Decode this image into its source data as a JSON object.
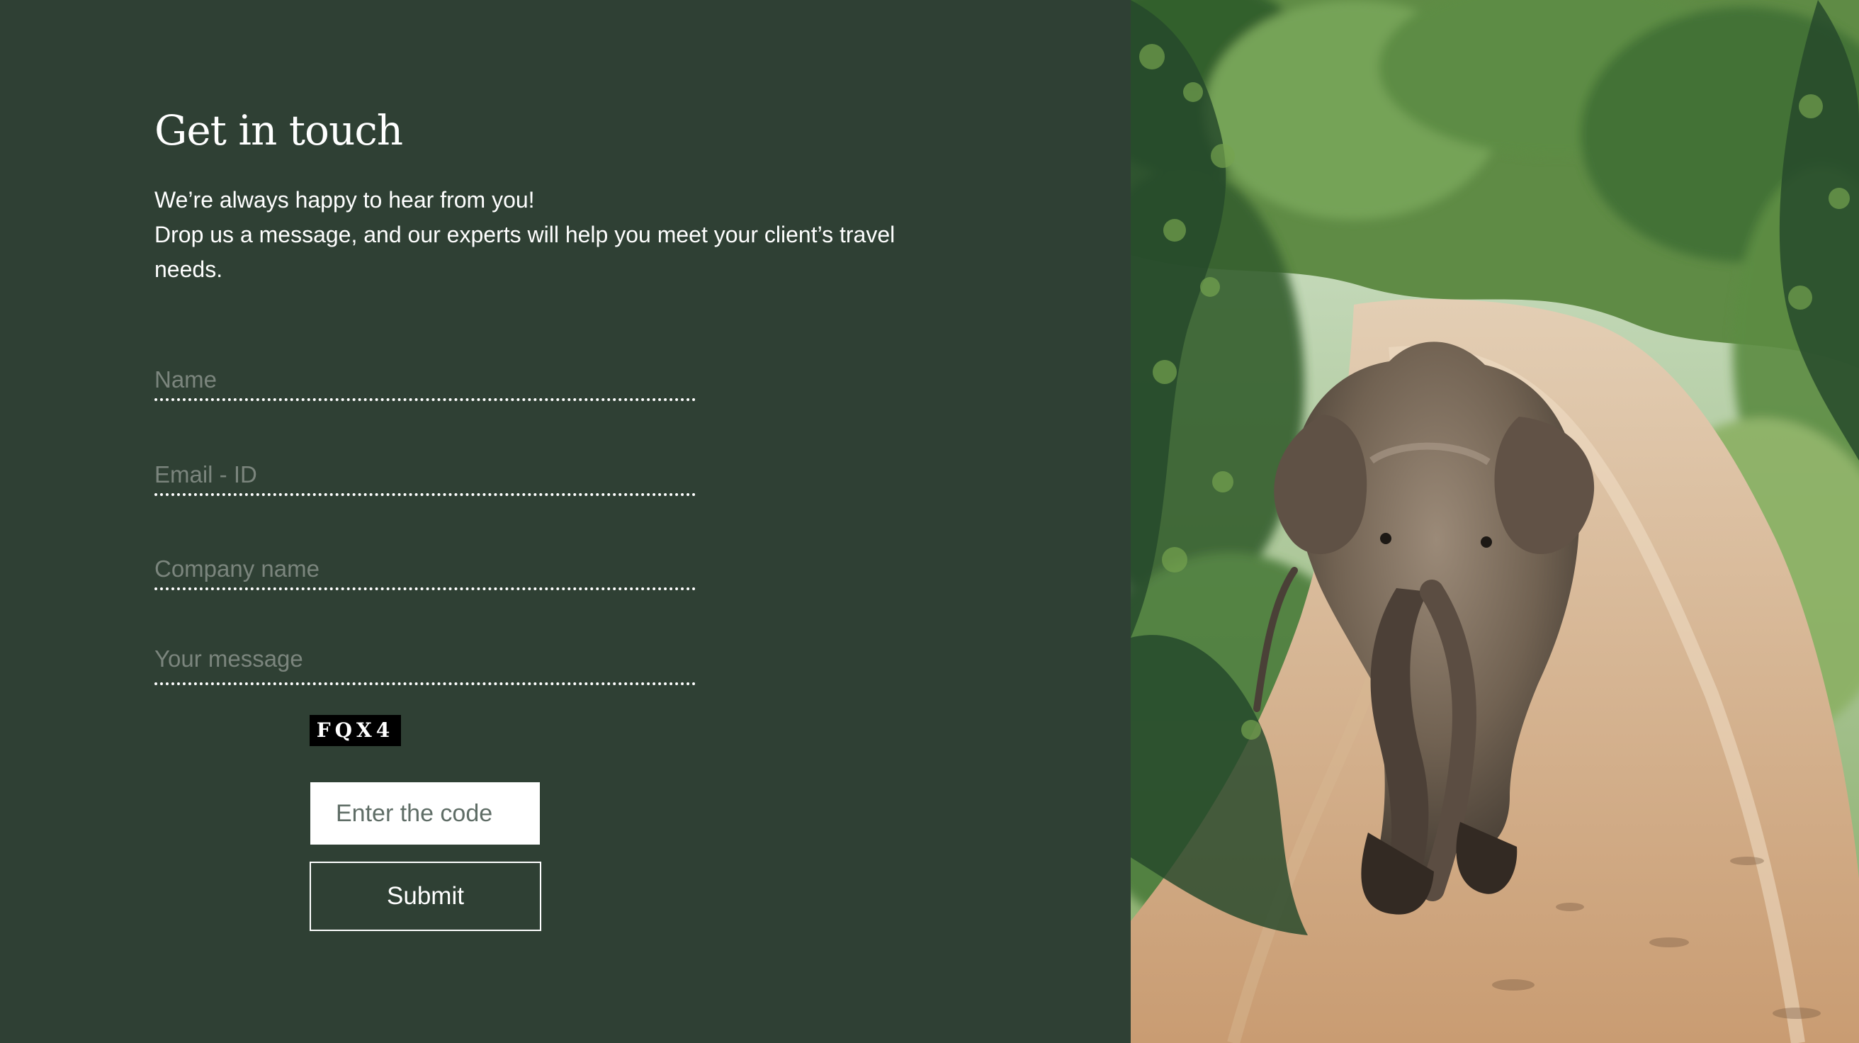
{
  "contact": {
    "title": "Get in touch",
    "intro_line1": "We’re always happy to hear from you!",
    "intro_line2": "Drop us a message, and our experts will help you meet your client’s travel needs."
  },
  "form": {
    "name_placeholder": "Name",
    "email_placeholder": "Email - ID",
    "company_placeholder": "Company name",
    "message_placeholder": "Your message",
    "captcha_text": "FQX4",
    "code_placeholder": "Enter the code",
    "submit_label": "Submit"
  },
  "colors": {
    "panel_background": "#2f4034",
    "text": "#ffffff",
    "placeholder": "#7b857d"
  }
}
